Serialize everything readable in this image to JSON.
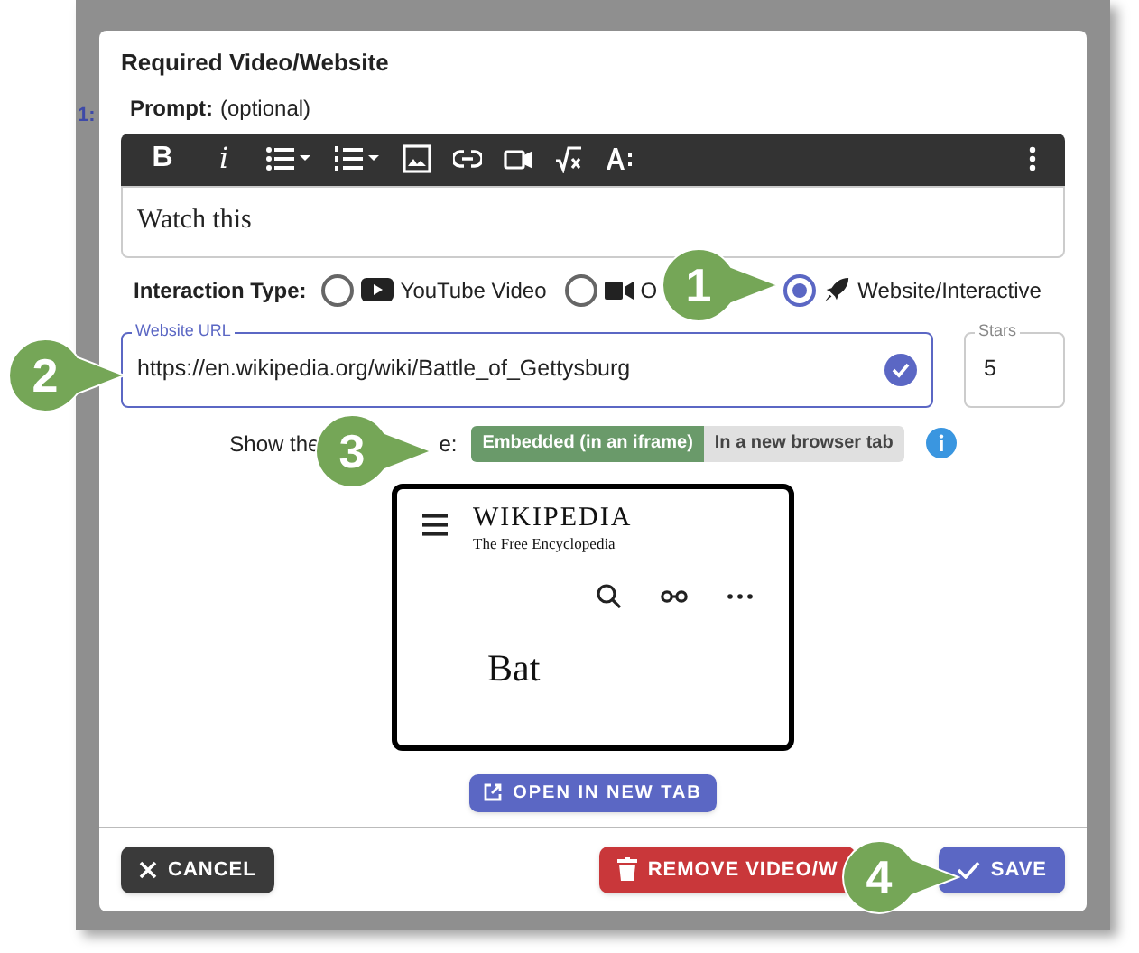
{
  "background": {
    "label": "1:"
  },
  "dialog": {
    "title": "Required Video/Website",
    "prompt_label": "Prompt:",
    "prompt_hint": "(optional)",
    "toolbar": [
      {
        "kind": "text",
        "label": "B"
      },
      {
        "kind": "italic",
        "label": "i"
      },
      {
        "kind": "bullet-list"
      },
      {
        "kind": "numbered-list"
      },
      {
        "kind": "image"
      },
      {
        "kind": "link"
      },
      {
        "kind": "video"
      },
      {
        "kind": "formula"
      },
      {
        "kind": "text-size"
      },
      {
        "kind": "more"
      }
    ],
    "editor_text": "Watch this",
    "interaction_type": {
      "label": "Interaction Type:",
      "options": [
        {
          "kind": "youtube",
          "label": "YouTube Video",
          "selected": false
        },
        {
          "kind": "video",
          "label": "O",
          "selected": false
        },
        {
          "kind": "website",
          "label": "Website/Interactive",
          "selected": true
        }
      ]
    },
    "url_field": {
      "label": "Website URL",
      "value": "https://en.wikipedia.org/wiki/Battle_of_Gettysburg",
      "valid": true
    },
    "stars_field": {
      "label": "Stars",
      "value": "5"
    },
    "show_mode": {
      "label_start": "Show the",
      "label_end": "e:",
      "options": [
        {
          "label": "Embedded (in an iframe)",
          "selected": true
        },
        {
          "label": "In a new browser tab",
          "selected": false
        }
      ]
    },
    "preview": {
      "wordmark": "WIKIPEDIA",
      "tagline": "The Free Encyclopedia",
      "heading": "Bat"
    },
    "open_button": "OPEN IN NEW TAB",
    "buttons": [
      {
        "kind": "cancel",
        "label": "CANCEL"
      },
      {
        "kind": "remove",
        "label": "REMOVE VIDEO/W"
      },
      {
        "kind": "save",
        "label": "SAVE"
      }
    ]
  },
  "callouts": [
    {
      "label": "1"
    },
    {
      "label": "2"
    },
    {
      "label": "3"
    },
    {
      "label": "4"
    }
  ]
}
